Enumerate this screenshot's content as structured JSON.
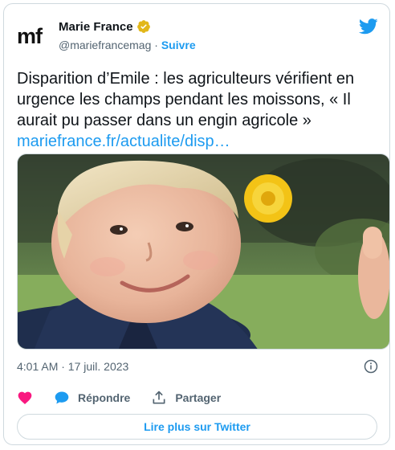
{
  "tweet": {
    "logo_text": "mf",
    "author_name": "Marie France",
    "handle": "@mariefrancemag",
    "separator": " · ",
    "follow_label": "Suivre",
    "text": "Disparition d’Emile : les agriculteurs vérifient en urgence les champs pendant les moissons, « Il aurait pu passer dans un engin agricole »",
    "link": "mariefrance.fr/actualite/disp…",
    "timestamp": "4:01 AM · 17 juil. 2023"
  },
  "actions": {
    "reply_label": "Répondre",
    "share_label": "Partager"
  },
  "read_more_label": "Lire plus sur Twitter",
  "colors": {
    "accent": "#1d9bf0",
    "like": "#f91880",
    "verified_gold": "#e2b719",
    "secondary_text": "#536471",
    "border": "#cfd9de"
  },
  "icons": [
    "verified-badge-icon",
    "twitter-bird-icon",
    "info-icon",
    "heart-icon",
    "reply-bubble-icon",
    "share-icon"
  ]
}
